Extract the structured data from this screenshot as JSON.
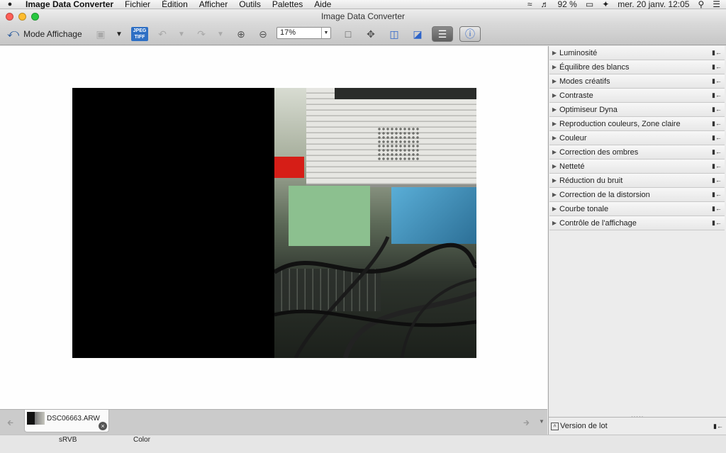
{
  "menubar": {
    "app_name": "Image Data Converter",
    "items": [
      "Fichier",
      "Édition",
      "Afficher",
      "Outils",
      "Palettes",
      "Aide"
    ],
    "battery": "92 %",
    "datetime": "mer. 20 janv.  12:05"
  },
  "window": {
    "title": "Image Data Converter"
  },
  "toolbar": {
    "mode_label": "Mode Affichage",
    "jpeg_tiff_top": "JPEG",
    "jpeg_tiff_bottom": "TIFF",
    "zoom_value": "17%"
  },
  "palette": {
    "items": [
      "Luminosité",
      "Équilibre des blancs",
      "Modes créatifs",
      "Contraste",
      "Optimiseur Dyna",
      "Reproduction couleurs, Zone claire",
      "Couleur",
      "Correction des ombres",
      "Netteté",
      "Réduction du bruit",
      "Correction de la distorsion",
      "Courbe tonale",
      "Contrôle de l'affichage"
    ],
    "batch_label": "Version de lot"
  },
  "thumbnail": {
    "filename": "DSC06663.ARW"
  },
  "status": {
    "colorspace": "sRVB",
    "mode": "Color"
  },
  "colors": {
    "accent": "#2c63c9",
    "canvas": "#fefefe",
    "chrome": "#ececec"
  }
}
